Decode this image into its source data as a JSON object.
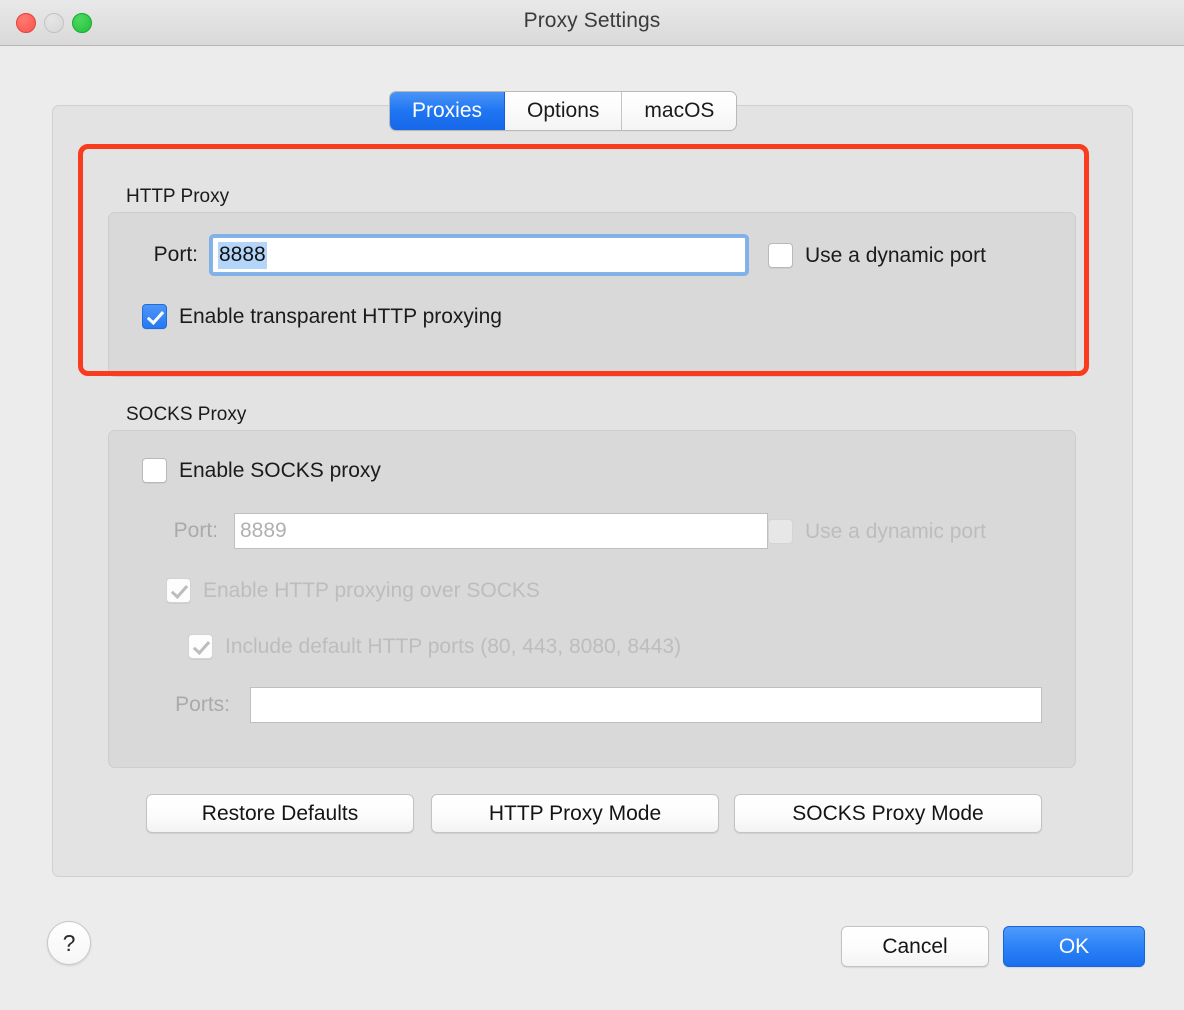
{
  "window": {
    "title": "Proxy Settings",
    "controls": [
      {
        "name": "close",
        "label": "Close"
      },
      {
        "name": "minimize",
        "label": "Minimize"
      },
      {
        "name": "zoom",
        "label": "Zoom"
      }
    ]
  },
  "tabs": [
    {
      "label": "Proxies",
      "selected": true
    },
    {
      "label": "Options",
      "selected": false
    },
    {
      "label": "macOS",
      "selected": false
    }
  ],
  "http_proxy": {
    "group_label": "HTTP Proxy",
    "port_label": "Port:",
    "port_value": "8888",
    "port_selected": true,
    "dynamic_port_label": "Use a dynamic port",
    "dynamic_port_checked": false,
    "transparent_label": "Enable transparent HTTP proxying",
    "transparent_checked": true
  },
  "socks_proxy": {
    "group_label": "SOCKS Proxy",
    "enable_label": "Enable SOCKS proxy",
    "enable_checked": false,
    "port_label": "Port:",
    "port_placeholder": "8889",
    "port_value": "",
    "dynamic_port_label": "Use a dynamic port",
    "dynamic_port_checked": false,
    "http_over_socks_label": "Enable HTTP proxying over SOCKS",
    "http_over_socks_checked": true,
    "default_ports_label": "Include default HTTP ports (80, 443, 8080, 8443)",
    "default_ports_checked": true,
    "ports_label": "Ports:",
    "ports_value": ""
  },
  "mode_buttons": [
    {
      "label": "Restore Defaults"
    },
    {
      "label": "HTTP Proxy Mode"
    },
    {
      "label": "SOCKS Proxy Mode"
    }
  ],
  "footer": {
    "help_label": "?",
    "cancel_label": "Cancel",
    "ok_label": "OK"
  },
  "annotation": {
    "color": "#fa3c1e",
    "target": "HTTP Proxy section highlight"
  },
  "colors": {
    "accent": "#2479f4",
    "annotation": "#fa3c1e",
    "window_bg": "#ececec",
    "panel_bg": "#e3e3e3",
    "group_bg": "#d9d9d9"
  }
}
